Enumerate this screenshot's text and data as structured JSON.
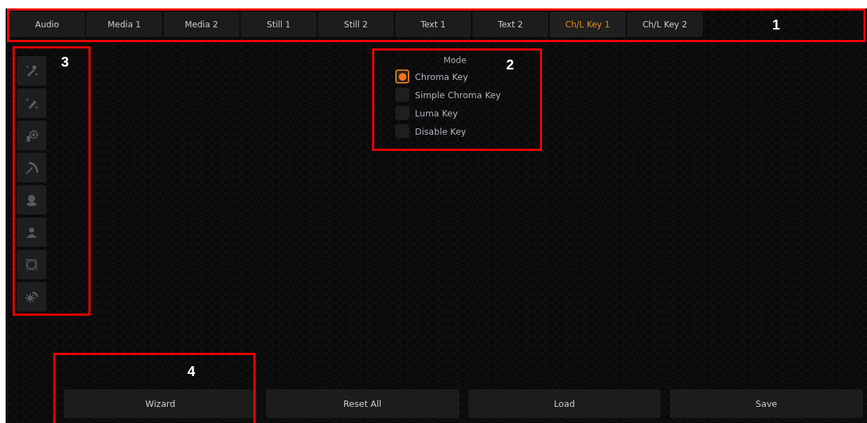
{
  "tabs": [
    {
      "label": "Audio",
      "selected": false
    },
    {
      "label": "Media 1",
      "selected": false
    },
    {
      "label": "Media 2",
      "selected": false
    },
    {
      "label": "Still 1",
      "selected": false
    },
    {
      "label": "Still 2",
      "selected": false
    },
    {
      "label": "Text 1",
      "selected": false
    },
    {
      "label": "Text 2",
      "selected": false
    },
    {
      "label": "Ch/L Key 1",
      "selected": true
    },
    {
      "label": "Ch/L Key 2",
      "selected": false
    }
  ],
  "mode": {
    "title": "Mode",
    "options": [
      {
        "label": "Chroma Key",
        "selected": true
      },
      {
        "label": "Simple Chroma Key",
        "selected": false
      },
      {
        "label": "Luma Key",
        "selected": false
      },
      {
        "label": "Disable Key",
        "selected": false
      }
    ]
  },
  "buttons": [
    "Wizard",
    "Reset All",
    "Load",
    "Save"
  ],
  "callouts": [
    "1",
    "2",
    "3",
    "4"
  ]
}
